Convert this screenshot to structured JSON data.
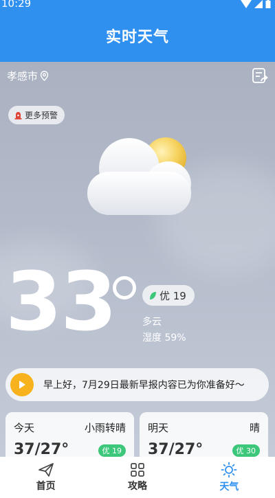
{
  "status_bar": {
    "time": "10:29"
  },
  "header": {
    "title": "实时天气"
  },
  "location": {
    "name": "孝感市"
  },
  "alert": {
    "label": "更多预警"
  },
  "current": {
    "temperature": "33",
    "aqi_label": "优 19",
    "condition": "多云",
    "humidity": "湿度 59%",
    "icon": "partly-cloudy-icon"
  },
  "broadcast": {
    "text": "早上好，7月29日最新早报内容已为你准备好～"
  },
  "forecast": [
    {
      "day": "今天",
      "condition": "小雨转晴",
      "temp": "37/27°",
      "aqi": "优 19"
    },
    {
      "day": "明天",
      "condition": "晴",
      "temp": "37/27°",
      "aqi": "优 30"
    }
  ],
  "tabs": [
    {
      "label": "首页",
      "icon": "paper-plane-icon"
    },
    {
      "label": "攻略",
      "icon": "grid-icon"
    },
    {
      "label": "天气",
      "icon": "sun-icon",
      "active": true
    }
  ],
  "colors": {
    "primary": "#2f90f0",
    "aqi_green": "#3cc77b",
    "play_yellow": "#f7b21d"
  }
}
